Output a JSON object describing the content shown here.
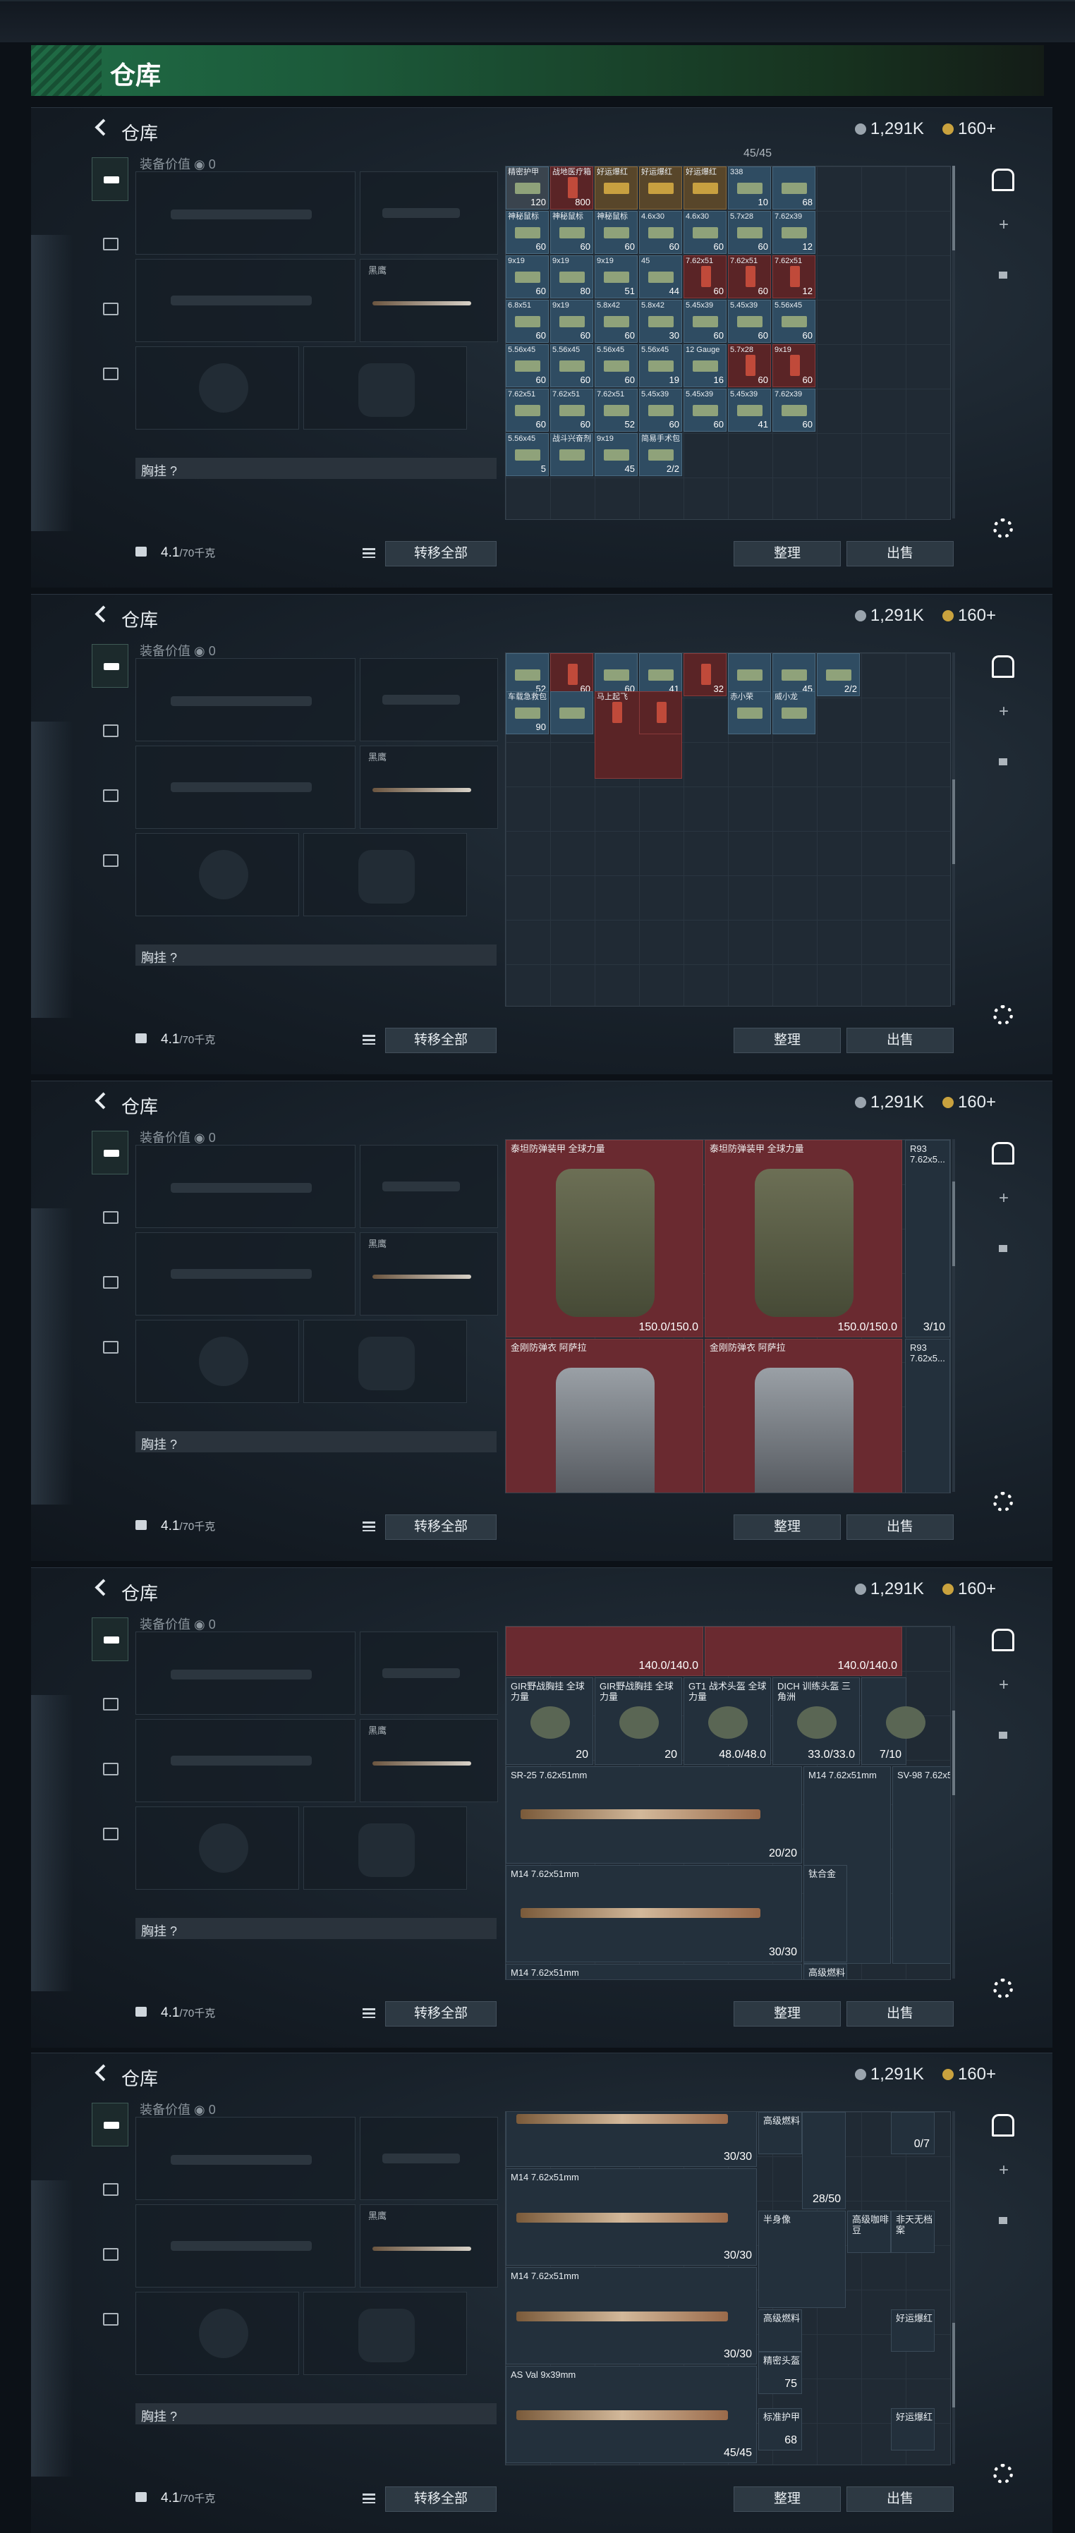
{
  "page": {
    "title": "仓库"
  },
  "panels": [
    {
      "id": "p1",
      "title": "仓库",
      "currency": {
        "silver": "1,291K",
        "gold": "160+"
      },
      "equip": {
        "value_label": "装备价值",
        "value": "0",
        "knife_label": "黑鹰",
        "chest_label": "胸挂 ?",
        "weight": "4.1",
        "weight_max": "/70千克",
        "transfer": "转移全部"
      },
      "stash": {
        "capacity": "45/45",
        "sort": "整理",
        "sell": "出售"
      },
      "items": [
        {
          "t": "精密护甲",
          "n": "120",
          "c": "gray"
        },
        {
          "t": "战地医疗箱",
          "n": "800",
          "c": "red"
        },
        {
          "t": "好运爆红",
          "n": "",
          "c": "amber"
        },
        {
          "t": "好运爆红",
          "n": "",
          "c": "amber"
        },
        {
          "t": "好运爆红",
          "n": "",
          "c": "amber"
        },
        {
          "t": "338",
          "n": "10",
          "c": ""
        },
        {
          "t": "",
          "n": "68",
          "c": ""
        },
        {
          "t": "神秘鼠标",
          "n": "60",
          "c": ""
        },
        {
          "t": "神秘鼠标",
          "n": "60",
          "c": ""
        },
        {
          "t": "神秘鼠标",
          "n": "60",
          "c": ""
        },
        {
          "t": "4.6x30",
          "n": "60",
          "c": ""
        },
        {
          "t": "4.6x30",
          "n": "60",
          "c": ""
        },
        {
          "t": "5.7x28",
          "n": "60",
          "c": ""
        },
        {
          "t": "7.62x39",
          "n": "12",
          "c": ""
        },
        {
          "t": "9x19",
          "n": "60",
          "c": ""
        },
        {
          "t": "9x19",
          "n": "80",
          "c": ""
        },
        {
          "t": "9x19",
          "n": "51",
          "c": ""
        },
        {
          "t": "45",
          "n": "44",
          "c": ""
        },
        {
          "t": "7.62x51",
          "n": "60",
          "c": "red"
        },
        {
          "t": "7.62x51",
          "n": "60",
          "c": "red"
        },
        {
          "t": "7.62x51",
          "n": "12",
          "c": "red"
        },
        {
          "t": "6.8x51",
          "n": "60",
          "c": ""
        },
        {
          "t": "9x19",
          "n": "60",
          "c": ""
        },
        {
          "t": "5.8x42",
          "n": "60",
          "c": ""
        },
        {
          "t": "5.8x42",
          "n": "30",
          "c": ""
        },
        {
          "t": "5.45x39",
          "n": "60",
          "c": ""
        },
        {
          "t": "5.45x39",
          "n": "60",
          "c": ""
        },
        {
          "t": "5.56x45",
          "n": "60",
          "c": ""
        },
        {
          "t": "5.56x45",
          "n": "60",
          "c": ""
        },
        {
          "t": "5.56x45",
          "n": "60",
          "c": ""
        },
        {
          "t": "5.56x45",
          "n": "60",
          "c": ""
        },
        {
          "t": "5.56x45",
          "n": "19",
          "c": ""
        },
        {
          "t": "12 Gauge",
          "n": "16",
          "c": ""
        },
        {
          "t": "5.7x28",
          "n": "60",
          "c": "red"
        },
        {
          "t": "9x19",
          "n": "60",
          "c": "red"
        },
        {
          "t": "7.62x51",
          "n": "60",
          "c": ""
        },
        {
          "t": "7.62x51",
          "n": "60",
          "c": ""
        },
        {
          "t": "7.62x51",
          "n": "52",
          "c": ""
        },
        {
          "t": "5.45x39",
          "n": "60",
          "c": ""
        },
        {
          "t": "5.45x39",
          "n": "60",
          "c": ""
        },
        {
          "t": "5.45x39",
          "n": "41",
          "c": ""
        },
        {
          "t": "7.62x39",
          "n": "60",
          "c": ""
        },
        {
          "t": "5.56x45",
          "n": "5",
          "c": ""
        },
        {
          "t": "战斗兴奋剂",
          "n": "",
          "c": ""
        },
        {
          "t": "9x19",
          "n": "45",
          "c": ""
        },
        {
          "t": "简易手术包",
          "n": "2/2",
          "c": ""
        }
      ]
    },
    {
      "id": "p2",
      "title": "仓库",
      "currency": {
        "silver": "1,291K",
        "gold": "160+"
      },
      "equip": {
        "value_label": "装备价值",
        "value": "0",
        "knife_label": "黑鹰",
        "chest_label": "胸挂 ?",
        "weight": "4.1",
        "weight_max": "/70千克",
        "transfer": "转移全部"
      },
      "stash": {
        "capacity": "",
        "sort": "整理",
        "sell": "出售"
      },
      "items": [
        {
          "t": "",
          "n": "52",
          "c": ""
        },
        {
          "t": "",
          "n": "60",
          "c": "red"
        },
        {
          "t": "",
          "n": "60",
          "c": ""
        },
        {
          "t": "",
          "n": "41",
          "c": ""
        },
        {
          "t": "",
          "n": "32",
          "c": "red"
        },
        {
          "t": "",
          "n": "",
          "c": ""
        },
        {
          "t": "",
          "n": "45",
          "c": ""
        },
        {
          "t": "",
          "n": "2/2",
          "c": ""
        },
        {
          "t": "车载急救包",
          "n": "90",
          "c": ""
        },
        {
          "t": "",
          "n": "",
          "c": ""
        },
        {
          "t": "马上起飞",
          "n": "",
          "c": "red"
        },
        {
          "t": "",
          "n": "",
          "c": "red"
        },
        {
          "t": "赤小荣",
          "n": "",
          "c": ""
        },
        {
          "t": "威小龙",
          "n": "",
          "c": ""
        }
      ]
    },
    {
      "id": "p3",
      "title": "仓库",
      "currency": {
        "silver": "1,291K",
        "gold": "160+"
      },
      "equip": {
        "value_label": "装备价值",
        "value": "0",
        "knife_label": "黑鹰",
        "chest_label": "胸挂 ?",
        "weight": "4.1",
        "weight_max": "/70千克",
        "transfer": "转移全部"
      },
      "stash": {
        "capacity": "",
        "sort": "整理",
        "sell": "出售"
      },
      "bigs": [
        {
          "t": "泰坦防弹装甲\n全球力量",
          "n": "150.0/150.0",
          "kind": "olive"
        },
        {
          "t": "泰坦防弹装甲\n全球力量",
          "n": "150.0/150.0",
          "kind": "olive"
        },
        {
          "t": "金刚防弹衣\n阿萨拉",
          "n": "",
          "kind": "steel"
        },
        {
          "t": "金刚防弹衣\n阿萨拉",
          "n": "",
          "kind": "steel"
        }
      ],
      "side": [
        {
          "t": "R93\n7.62x5...",
          "n": "3/10"
        },
        {
          "t": "R93\n7.62x5...",
          "n": ""
        }
      ]
    },
    {
      "id": "p4",
      "title": "仓库",
      "currency": {
        "silver": "1,291K",
        "gold": "160+"
      },
      "equip": {
        "value_label": "装备价值",
        "value": "0",
        "knife_label": "黑鹰",
        "chest_label": "胸挂 ?",
        "weight": "4.1",
        "weight_max": "/70千克",
        "transfer": "转移全部"
      },
      "stash": {
        "capacity": "",
        "sort": "整理",
        "sell": "出售"
      },
      "top": [
        {
          "n": "140.0/140.0"
        },
        {
          "n": "140.0/140.0"
        }
      ],
      "helms": [
        {
          "t": "GIR野战胸挂\n全球力量",
          "n": "20"
        },
        {
          "t": "GIR野战胸挂\n全球力量",
          "n": "20"
        },
        {
          "t": "GT1 战术头盔\n全球力量",
          "n": "48.0/48.0"
        },
        {
          "t": "DICH 训练头盔\n三角洲",
          "n": "33.0/33.0"
        },
        {
          "t": "",
          "n": "7/10"
        }
      ],
      "guns": [
        {
          "t": "SR-25\n7.62x51mm",
          "n": "20/20"
        },
        {
          "t": "M14\n7.62x51mm",
          "n": "30/30"
        },
        {
          "t": "M14\n7.62x51mm",
          "n": ""
        }
      ],
      "misc": [
        {
          "t": "M14\n7.62x51mm",
          "n": ""
        },
        {
          "t": "SV-98\n7.62x5...",
          "n": ""
        },
        {
          "t": "钛合金",
          "n": ""
        },
        {
          "t": "高级燃料",
          "n": ""
        }
      ]
    },
    {
      "id": "p5",
      "title": "仓库",
      "currency": {
        "silver": "1,291K",
        "gold": "160+"
      },
      "equip": {
        "value_label": "装备价值",
        "value": "0",
        "knife_label": "黑鹰",
        "chest_label": "胸挂 ?",
        "weight": "4.1",
        "weight_max": "/70千克",
        "transfer": "转移全部"
      },
      "stash": {
        "capacity": "",
        "sort": "整理",
        "sell": "出售"
      },
      "guns": [
        {
          "t": "",
          "n": "30/30"
        },
        {
          "t": "M14\n7.62x51mm",
          "n": "30/30"
        },
        {
          "t": "M14\n7.62x51mm",
          "n": "30/30"
        },
        {
          "t": "AS Val\n9x39mm",
          "n": "45/45"
        }
      ],
      "misc": [
        {
          "t": "高级燃料",
          "n": ""
        },
        {
          "t": "",
          "n": "28/50"
        },
        {
          "t": "",
          "n": "0/7"
        },
        {
          "t": "半身像",
          "n": ""
        },
        {
          "t": "高级咖啡豆",
          "n": ""
        },
        {
          "t": "非天无档案",
          "n": ""
        },
        {
          "t": "高级燃料",
          "n": ""
        },
        {
          "t": "好运爆红",
          "n": ""
        },
        {
          "t": "精密头盔",
          "n": "75"
        },
        {
          "t": "标准护甲",
          "n": "68"
        },
        {
          "t": "好运爆红",
          "n": ""
        }
      ]
    }
  ]
}
